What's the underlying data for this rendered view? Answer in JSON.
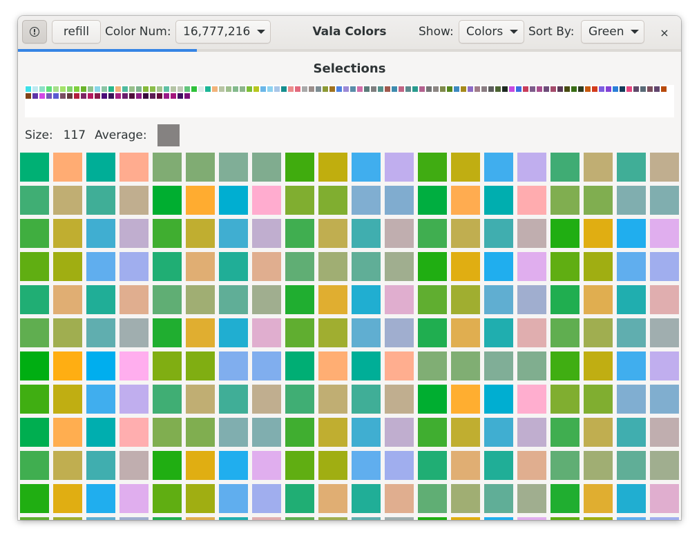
{
  "window": {
    "title": "Vala Colors"
  },
  "toolbar": {
    "info_icon": "info-circle-icon",
    "refill_label": "refill",
    "color_num_label": "Color Num:",
    "color_num_value": "16,777,216",
    "show_label": "Show:",
    "show_value": "Colors",
    "sort_label": "Sort By:",
    "sort_value": "Green",
    "close_glyph": "×"
  },
  "progress": {
    "fraction": 0.27
  },
  "selections": {
    "title": "Selections",
    "swatches": [
      "#3ee0e8",
      "#bfe9f0",
      "#8de0c6",
      "#5fe07b",
      "#a6df8a",
      "#a4e26a",
      "#82d46a",
      "#7fcf3e",
      "#6ab32a",
      "#8ec28f",
      "#89d6e8",
      "#8cc4a5",
      "#27b78a",
      "#f0b27a",
      "#4fba9e",
      "#98bf8b",
      "#7eb48d",
      "#86b93a",
      "#8bbd4a",
      "#a4c58f",
      "#5fc0a4",
      "#b5c4a5",
      "#c0c8b6",
      "#63c47c",
      "#2fc13a",
      "#dfeaea",
      "#1db696",
      "#f2b37b",
      "#b8c4a3",
      "#9fbf8d",
      "#84ba8d",
      "#8db58b",
      "#7dbf35",
      "#b8c61f",
      "#6bb7e8",
      "#8ed2f0",
      "#a9c6e8",
      "#168f8f",
      "#ec8d8d",
      "#e36a7d",
      "#a9a9a9",
      "#9a8e8a",
      "#7d8d93",
      "#8d9a36",
      "#a0721f",
      "#4e82e0",
      "#9c8ad6",
      "#5a8da9",
      "#d06ea9",
      "#5b7c7a",
      "#7f7f7f",
      "#54918b",
      "#a05a4e",
      "#3f8cae",
      "#c06484",
      "#5d898d",
      "#2a9b8e",
      "#b3628f",
      "#757575",
      "#8d8784",
      "#7f8a4a",
      "#55881d",
      "#3e8ac0",
      "#a68a1b",
      "#8e6cc5",
      "#a07d8a",
      "#8a7d82",
      "#5d5d5d",
      "#4c6433",
      "#1f2a22",
      "#c64ae0",
      "#3a6ee2",
      "#c83e5c",
      "#7e5c8b",
      "#a84e8d",
      "#6e4d7a",
      "#a44c6b",
      "#5a3b58",
      "#484b12",
      "#3a6e16",
      "#2e3b20",
      "#c75a10",
      "#d23c1d",
      "#7c5ee0",
      "#8441d6",
      "#2b7fd8",
      "#143c5a",
      "#e5467f",
      "#5f4a6a",
      "#5a6b77",
      "#7b4f5e",
      "#62466e",
      "#b84a0c",
      "#804217",
      "#5d35a9",
      "#d248e5",
      "#7357b8",
      "#5b5bd2",
      "#7a4f63",
      "#663a3e",
      "#b31f3d",
      "#7c2565",
      "#b4185f",
      "#8b1a4c",
      "#4a0d7a",
      "#3b1258",
      "#a51d82",
      "#6a1f6d",
      "#4f0f3b",
      "#8b1b81",
      "#3a0c3e",
      "#5c1d55",
      "#650c3c",
      "#9a1a88",
      "#a3157c",
      "#400f60",
      "#7a0f79"
    ]
  },
  "stats": {
    "size_label": "Size:",
    "size_value": "117",
    "average_label": "Average:",
    "average_color": "#858281"
  },
  "grid": {
    "columns": 20,
    "rows": [
      [
        "#00b074",
        "#ffac73",
        "#00ae97",
        "#ffac8f",
        "#80ac73",
        "#80ac73",
        "#80ae97",
        "#80ac8f",
        "#40ac0e",
        "#c0ae0e",
        "#40aeee",
        "#c0aeee",
        "#40ac12",
        "#c0ae12",
        "#40aeee",
        "#c0aeee",
        "#40ac74",
        "#c0ae73",
        "#40ae97",
        "#c0ae8f"
      ],
      [
        "#40ae74",
        "#c0ae73",
        "#40ae97",
        "#c0ae8f",
        "#00ae30",
        "#ffac30",
        "#00aed1",
        "#ffaccf",
        "#80ae30",
        "#80ae30",
        "#80aed1",
        "#80accf",
        "#00ae40",
        "#ffac50",
        "#00aeaf",
        "#ffacaf",
        "#80ae50",
        "#80ae50",
        "#80aeaf",
        "#80aeaf"
      ],
      [
        "#40ae40",
        "#c0ae30",
        "#40aed1",
        "#c0aecf",
        "#40ae30",
        "#c0ae30",
        "#40aed1",
        "#c0aecf",
        "#40ae50",
        "#c0ae50",
        "#40aeaf",
        "#c0aeaf",
        "#40ae50",
        "#c0ae50",
        "#40aeaf",
        "#c0aeaf",
        "#20ae12",
        "#e0ae12",
        "#20aeee",
        "#e0aeee"
      ],
      [
        "#60ae12",
        "#a0ae12",
        "#60aeee",
        "#a0aeee",
        "#20ae74",
        "#e0ae73",
        "#20ae97",
        "#e0ae8f",
        "#60ae74",
        "#a0ae73",
        "#60ae97",
        "#a0ae8f",
        "#20ae12",
        "#e0ae12",
        "#20aeee",
        "#e0aeee",
        "#60ae12",
        "#a0ae12",
        "#60aeee",
        "#a0aeee"
      ],
      [
        "#20ae74",
        "#e0ae73",
        "#20ae97",
        "#e0ae8f",
        "#60ae74",
        "#a0ae73",
        "#60ae97",
        "#a0ae8f",
        "#20ae30",
        "#e0ae30",
        "#20aed1",
        "#e0aecf",
        "#60ae30",
        "#a0ae30",
        "#60aed1",
        "#a0aecf",
        "#20ae50",
        "#e0ae50",
        "#20aeaf",
        "#e0aeaf"
      ],
      [
        "#60ae50",
        "#a0ae50",
        "#60aeaf",
        "#a0aeaf",
        "#20ae30",
        "#e0ae30",
        "#20aed1",
        "#e0aecf",
        "#60ae30",
        "#a0ae30",
        "#60aed1",
        "#a0aecf",
        "#20ae50",
        "#e0ae50",
        "#20aeaf",
        "#e0aeaf",
        "#60ae50",
        "#a0ae50",
        "#60aeaf",
        "#a0aeaf"
      ],
      [
        "#00ae12",
        "#ffae12",
        "#00aeee",
        "#ffaeee",
        "#80ae12",
        "#80ae12",
        "#80aeee",
        "#80aeee",
        "#00ae74",
        "#ffae73",
        "#00ae97",
        "#ffae8f",
        "#80ae74",
        "#80ae73",
        "#80ae97",
        "#80ae8f",
        "#40ae12",
        "#c0ae12",
        "#40aeee",
        "#c0aeee"
      ],
      [
        "#40ae12",
        "#c0ae12",
        "#40aeee",
        "#c0aeee",
        "#40ae74",
        "#c0ae73",
        "#40ae97",
        "#c0ae8f",
        "#40ae74",
        "#c0ae73",
        "#40ae97",
        "#c0ae8f",
        "#00ae30",
        "#ffae30",
        "#00aed1",
        "#ffaecf",
        "#80ae30",
        "#80ae30",
        "#80aed1",
        "#80aecf"
      ],
      [
        "#00ae50",
        "#ffae50",
        "#00aeaf",
        "#ffaeaf",
        "#80ae50",
        "#80ae50",
        "#80aeaf",
        "#80aeaf",
        "#40ae30",
        "#c0ae30",
        "#40aed1",
        "#c0aecf",
        "#40ae30",
        "#c0ae30",
        "#40aed1",
        "#c0aecf",
        "#40ae50",
        "#c0ae50",
        "#40aeaf",
        "#c0aeaf"
      ],
      [
        "#40ae50",
        "#c0ae50",
        "#40aeaf",
        "#c0aeaf",
        "#20ae12",
        "#e0ae12",
        "#20aeee",
        "#e0aeee",
        "#60ae12",
        "#a0ae12",
        "#60aeee",
        "#a0aeee",
        "#20ae74",
        "#e0ae73",
        "#20ae97",
        "#e0ae8f",
        "#60ae74",
        "#a0ae73",
        "#60ae97",
        "#a0ae8f"
      ],
      [
        "#20ae12",
        "#e0ae12",
        "#20aeee",
        "#e0aeee",
        "#60ae12",
        "#a0ae12",
        "#60aeee",
        "#a0aeee",
        "#20ae74",
        "#e0ae73",
        "#20ae97",
        "#e0ae8f",
        "#60ae74",
        "#a0ae73",
        "#60ae97",
        "#a0ae8f",
        "#20ae30",
        "#e0ae30",
        "#20aed1",
        "#e0aecf"
      ],
      [
        "#60ae30",
        "#a0ae30",
        "#60aed1",
        "#a0aecf",
        "#20ae50",
        "#e0ae50",
        "#20aeaf",
        "#e0aeaf",
        "#60ae50",
        "#a0ae50",
        "#60aeaf",
        "#a0aeaf",
        "#20ae12",
        "#e0ae12",
        "#20aeee",
        "#e0aeee",
        "#60ae12",
        "#a0ae12",
        "#60aeee",
        "#a0aeee"
      ]
    ]
  }
}
